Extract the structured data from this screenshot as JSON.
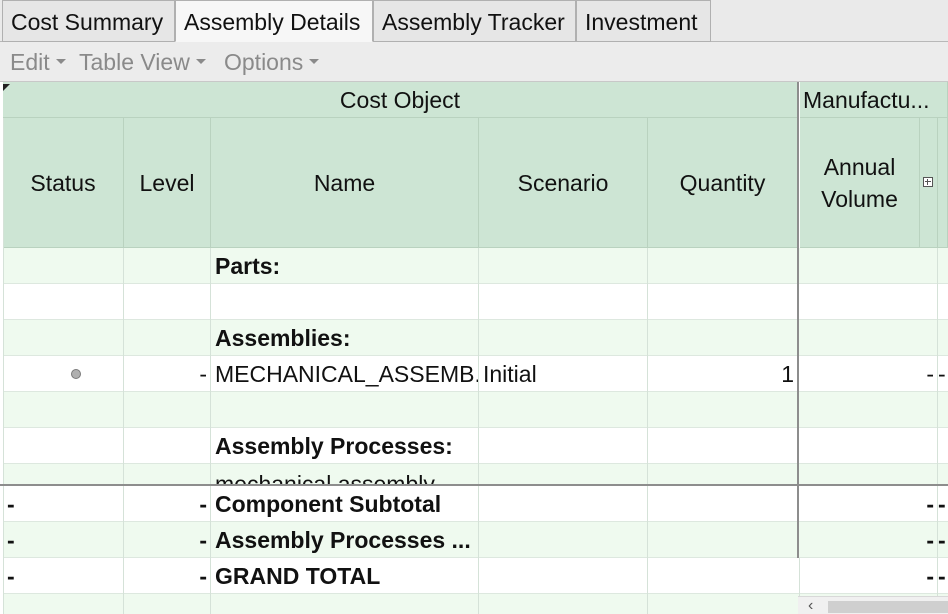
{
  "tabs": [
    {
      "label": "Cost Summary",
      "active": false
    },
    {
      "label": "Assembly Details",
      "active": true
    },
    {
      "label": "Assembly Tracker",
      "active": false
    },
    {
      "label": "Investment",
      "active": false
    }
  ],
  "toolbar": {
    "edit_label": "Edit",
    "table_view_label": "Table View",
    "options_label": "Options"
  },
  "grid": {
    "groups": {
      "cost_object": "Cost Object",
      "manufacturing": "Manufactu..."
    },
    "columns": {
      "status": "Status",
      "level": "Level",
      "name": "Name",
      "scenario": "Scenario",
      "quantity": "Quantity",
      "annual_volume": "Annual Volume"
    },
    "rows": [
      {
        "status": "",
        "level": "",
        "name": "Parts:",
        "scenario": "",
        "quantity": "",
        "volume": "",
        "extra": ""
      },
      {
        "status": "",
        "level": "",
        "name": "",
        "scenario": "",
        "quantity": "",
        "volume": "",
        "extra": ""
      },
      {
        "status": "",
        "level": "",
        "name": "Assemblies:",
        "scenario": "",
        "quantity": "",
        "volume": "",
        "extra": ""
      },
      {
        "status": "",
        "level": "-",
        "name": "MECHANICAL_ASSEMB...",
        "scenario": "Initial",
        "quantity": "1",
        "volume": "-",
        "extra": "-"
      },
      {
        "status": "",
        "level": "",
        "name": "",
        "scenario": "",
        "quantity": "",
        "volume": "",
        "extra": ""
      },
      {
        "status": "",
        "level": "",
        "name": "Assembly  Processes:",
        "scenario": "",
        "quantity": "",
        "volume": "",
        "extra": ""
      },
      {
        "status": "",
        "level": "",
        "name": "mechanical assembly",
        "scenario": "",
        "quantity": "",
        "volume": "",
        "extra": ""
      }
    ],
    "summary_rows": [
      {
        "status": "-",
        "level": "-",
        "name": "Component Subtotal",
        "volume": "-",
        "extra": "-"
      },
      {
        "status": "-",
        "level": "-",
        "name": "Assembly Processes ...",
        "volume": "-",
        "extra": "-"
      },
      {
        "status": "-",
        "level": "-",
        "name": "GRAND TOTAL",
        "volume": "-",
        "extra": "-"
      }
    ]
  },
  "icons": {
    "status": "status-dot-icon",
    "expand": "expand-column-icon",
    "scroll_left": "chevron-left-icon"
  },
  "colors": {
    "header_bg": "#cde5d4",
    "row_alt_bg": "#effaef"
  }
}
